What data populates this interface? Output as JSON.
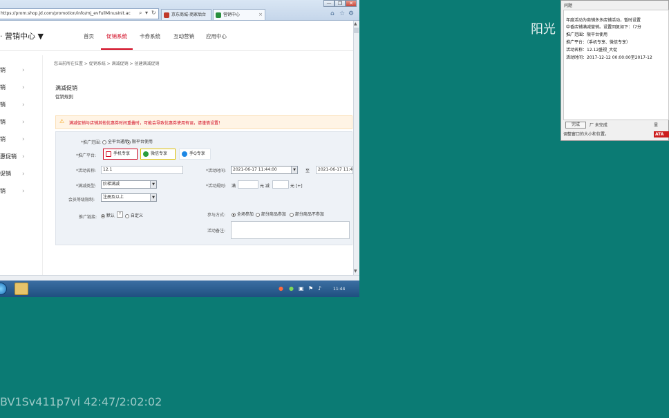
{
  "browser": {
    "url": "https://prom.shop.jd.com/promotion/info/mj_evFullMinusInit.ac",
    "addr_icons": [
      "search-icon",
      "dropdown-arrow",
      "refresh-icon"
    ],
    "tabs": [
      {
        "label": "京东商城-商家后台",
        "color": "#c0392b"
      },
      {
        "label": "营销中心",
        "color": "#2a8f3e"
      }
    ],
    "window_buttons": [
      "—",
      "❐",
      "✕"
    ]
  },
  "header": {
    "brand": "· 营销中心 ▼",
    "nav": [
      "首页",
      "促销系统",
      "卡券系统",
      "互动营销",
      "应用中心"
    ],
    "active_nav": "促销系统"
  },
  "sidebar": {
    "items": [
      "销",
      "销",
      "销",
      "销",
      "销",
      "惠促销",
      "促销",
      "销"
    ]
  },
  "content": {
    "breadcrumb": "您当前所在位置 > 促销系统 > 满减促销 > 创建满减促销",
    "title": "满减促销",
    "subtitle": "促销规则",
    "warning": "满减促销与店铺其他优惠券时间重叠时，可能会导致优惠券使用有误，请谨慎设置！",
    "form": {
      "range_label": "*推广范围:",
      "range_options": [
        "全平台通用",
        "限平台使用"
      ],
      "platform_label": "*推广平台:",
      "platforms": [
        {
          "label": "手机专享",
          "color": "#d0021b"
        },
        {
          "label": "微信专享",
          "color": "#2a9d3e"
        },
        {
          "label": "手Q专享",
          "color": "#1e88e5"
        }
      ],
      "name_label": "*活动名称:",
      "name_value": "12.1",
      "time_label": "*活动时间:",
      "time_start": "2021-06-17 11:44:00",
      "time_to": "至",
      "time_end": "2021-06-17 11:4",
      "type_label": "*满减类型:",
      "type_value": "阶梯满减",
      "rule_label": "*活动规则:",
      "rule_full": "满",
      "rule_yuan_minus": "元 减",
      "rule_yuan": "元 [+]",
      "member_label": "会员等级限制:",
      "member_value": "注册及以上",
      "link_label": "推广链接:",
      "link_default": "默认",
      "link_custom": "自定义",
      "participate_label": "参与方式:",
      "participate_options": [
        "全场参加",
        "部分商品参加",
        "部分商品不参加"
      ],
      "remark_label": "活动备注:"
    }
  },
  "taskbar": {
    "clock": "11:44"
  },
  "dialog": {
    "title": "问题",
    "lines": [
      "年度活动为商铺多多店铺活动，暂时设置",
      "中香店铺满减营销。设置回复如下：（7分",
      "推广范围：限平台使用",
      "推广平台：（手机专享、微信专享）",
      "活动名称：12.12盛视_大促",
      "活动时间：2017-12-12 00:00:00至2017-12"
    ],
    "done_button": "完成",
    "checkbox": "厂 未完成",
    "footer": "调整窗口的大小和位置。",
    "badge": "ATA",
    "right_button": "里"
  },
  "overlay": {
    "channel": "阳光",
    "video_id": "BV1Sv411p7vi 42:47/2:02:02"
  },
  "colors": {
    "desktop": "#0b7b74",
    "accent": "#d0021b",
    "warning_bg": "#fff4e5"
  }
}
